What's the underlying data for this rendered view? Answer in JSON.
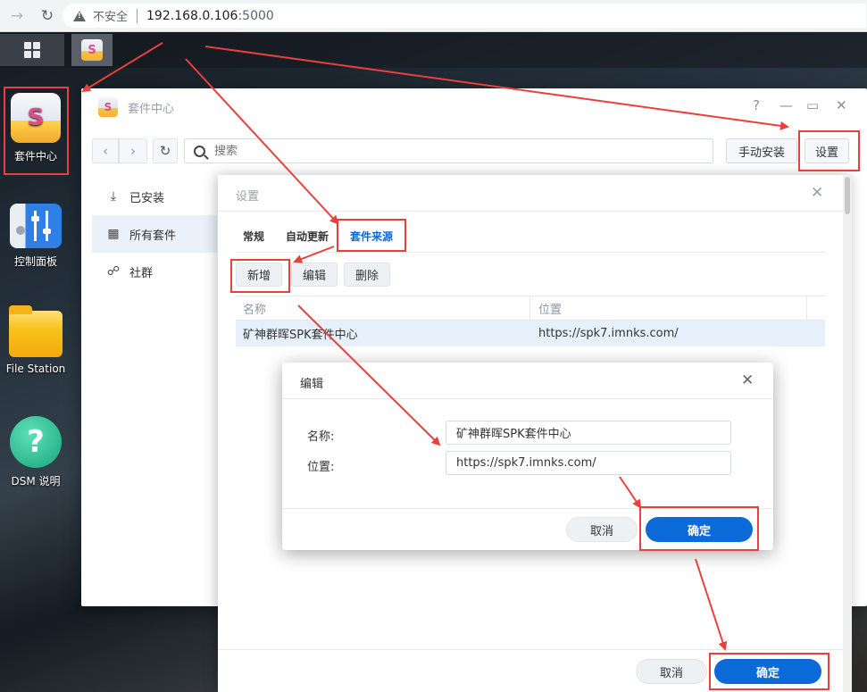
{
  "browser": {
    "insecure_label": "不安全",
    "url_host": "192.168.0.106",
    "url_port": ":5000"
  },
  "desktop": {
    "icons": [
      {
        "label": "套件中心",
        "icon": "package-center-icon"
      },
      {
        "label": "控制面板",
        "icon": "control-panel-icon"
      },
      {
        "label": "File Station",
        "icon": "file-station-icon"
      },
      {
        "label": "DSM 说明",
        "icon": "help-icon"
      }
    ],
    "taskbar_pkg_glyph": "S"
  },
  "package_center": {
    "title": "套件中心",
    "title_glyph": "S",
    "window_controls": {
      "help": "?",
      "minimize": "—",
      "maximize": "▭",
      "close": "✕"
    },
    "toolbar": {
      "back": "‹",
      "forward": "›",
      "refresh": "↻",
      "search_placeholder": "搜索",
      "manual_install": "手动安装",
      "settings": "设置"
    },
    "sidebar": [
      {
        "label": "已安装",
        "icon": "download-icon",
        "glyph": "⤓"
      },
      {
        "label": "所有套件",
        "icon": "grid-icon",
        "glyph": "▦"
      },
      {
        "label": "社群",
        "icon": "community-icon",
        "glyph": "☍"
      }
    ]
  },
  "settings": {
    "title": "设置",
    "close": "✕",
    "tabs": [
      {
        "label": "常规"
      },
      {
        "label": "自动更新"
      },
      {
        "label": "套件来源",
        "active": true
      }
    ],
    "actions": {
      "add": "新增",
      "edit": "编辑",
      "delete": "删除"
    },
    "table": {
      "columns": [
        "名称",
        "位置"
      ],
      "rows": [
        {
          "name": "矿神群晖SPK套件中心",
          "location": "https://spk7.imnks.com/"
        }
      ]
    },
    "cancel": "取消",
    "ok": "确定"
  },
  "edit_dialog": {
    "title": "编辑",
    "close": "✕",
    "name_label": "名称:",
    "name_value": "矿神群晖SPK套件中心",
    "location_label": "位置:",
    "location_value": "https://spk7.imnks.com/",
    "cancel": "取消",
    "ok": "确定"
  },
  "colors": {
    "accent": "#0a6ad8",
    "annotation": "#e8413c"
  }
}
